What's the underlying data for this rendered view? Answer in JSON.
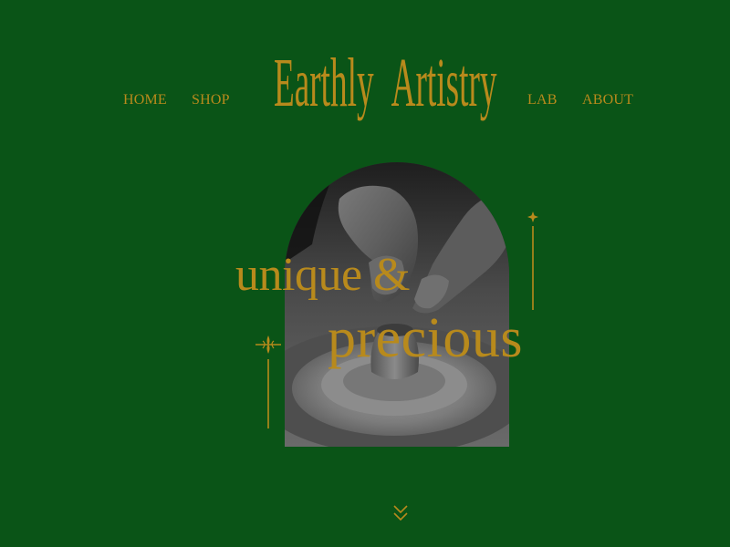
{
  "colors": {
    "background": "#0a5417",
    "accent": "#b88a1c"
  },
  "nav": {
    "left": [
      {
        "label": "HOME"
      },
      {
        "label": "SHOP"
      }
    ],
    "right": [
      {
        "label": "LAB"
      },
      {
        "label": "ABOUT"
      }
    ]
  },
  "brand": {
    "name": "Earthly Artistry"
  },
  "hero": {
    "line1": "unique &",
    "line2": "precious",
    "image": "pottery-wheel-photo"
  },
  "icons": {
    "ornament_top": "sparkle-icon",
    "ornament_left": "flourish-icon",
    "scroll": "double-chevron-down-icon"
  }
}
